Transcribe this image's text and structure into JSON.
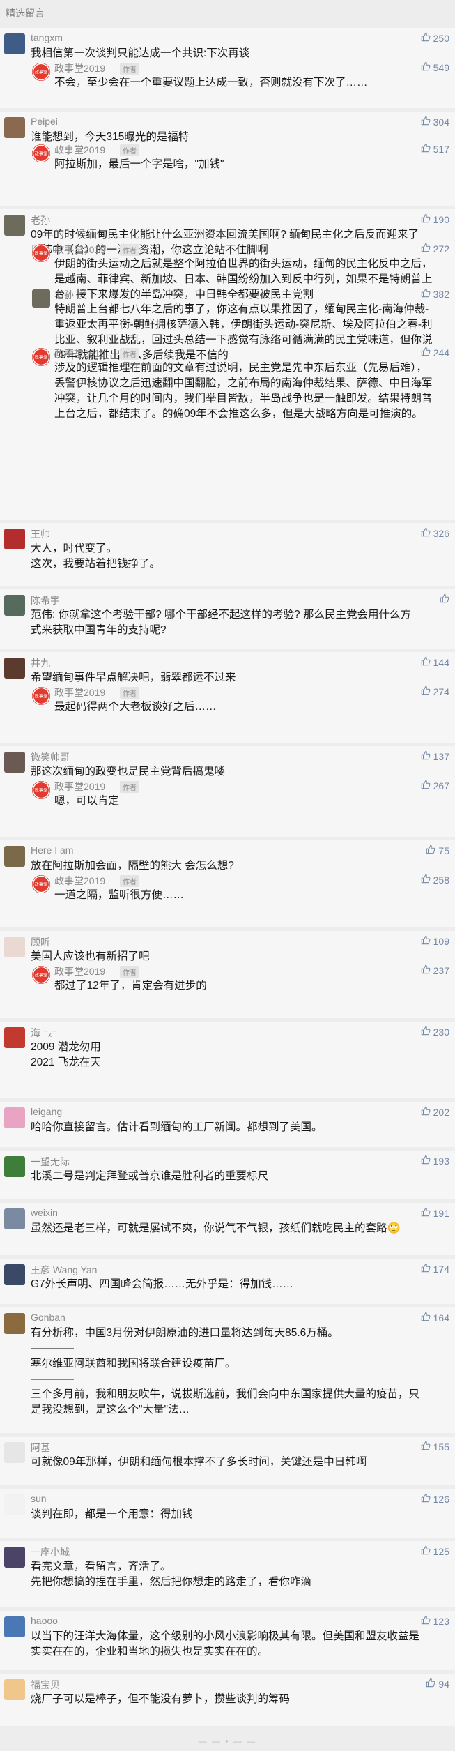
{
  "section_title": "精选留言",
  "author_tag": "作者",
  "reply_avatar_text": "政事堂",
  "emoji_glyph": "😄",
  "comments": [
    {
      "nick": "tangxm",
      "likes": "250",
      "text": "我相信第一次谈判只能达成一个共识:下次再谈",
      "avatar_color": "#3f5c86",
      "replies": [
        {
          "nick": "政事堂2019",
          "likes": "549",
          "text": "不会，至少会在一个重要议题上达成一致，否则就没有下次了……"
        }
      ]
    },
    {
      "nick": "Peipei",
      "likes": "304",
      "text": "谁能想到，今天315曝光的是福特",
      "avatar_color": "#8a6a4e",
      "replies": [
        {
          "nick": "政事堂2019",
          "likes": "517",
          "text": "阿拉斯加，最后一个字是啥，\"加钱\""
        }
      ]
    },
    {
      "nick": "老孙",
      "likes": "190",
      "text": "09年的时候缅甸民主化能让什么亚洲资本回流美国啊? 缅甸民主化之后反而迎来了日韩中（台）的一波投资潮，你这立论站不住脚啊",
      "avatar_color": "#6d6b5b",
      "replies": [
        {
          "nick": "政事堂2019",
          "likes": "272",
          "text": "伊朗的街头运动之后就是整个阿拉伯世界的街头运动，缅甸的民主化反中之后，是越南、菲律宾、新加坡、日本、韩国纷纷加入到反中行列，如果不是特朗普上台，接下来爆发的半岛冲突，中日韩全都要被民主党割"
        },
        {
          "nick": "老孙",
          "likes": "382",
          "text": "特朗普上台都七八年之后的事了，你这有点以果推因了，缅甸民主化-南海仲裁-重返亚太再平衡-朝鲜拥核萨德入韩，伊朗街头运动-突尼斯、埃及阿拉伯之春-利比亚、叙利亚战乱，回过头总结一下感觉有脉络可循满满的民主党味道，但你说09年就能推出这么多后续我是不信的"
        },
        {
          "nick": "政事堂2019",
          "likes": "244",
          "text": "涉及的逻辑推理在前面的文章有过说明，民主党是先中东后东亚（先易后难），丢警伊核协议之后迅速翻中国翻脸，之前布局的南海仲裁结果、萨德、中日海军冲突，让几个月的时间内，我们举目皆敌，半岛战争也是一触即发。结果特朗普上台之后，都结束了。的确09年不会推这么多，但是大战略方向是可推演的。"
        }
      ]
    },
    {
      "nick": "王帅",
      "likes": "326",
      "text": "大人，时代变了。\n这次，我要站着把钱挣了。",
      "avatar_color": "#b32d2d",
      "replies": []
    },
    {
      "nick": "陈希宇",
      "likes": "",
      "text": "范伟: 你就拿这个考验干部? 哪个干部经不起这样的考验? 那么民主党会用什么方式来获取中国青年的支持呢?",
      "avatar_color": "#556b5d",
      "replies": []
    },
    {
      "nick": "井九",
      "likes": "144",
      "text": "希望缅甸事件早点解决吧，翡翠都运不过来",
      "avatar_color": "#5a3b2e",
      "replies": [
        {
          "nick": "政事堂2019",
          "likes": "274",
          "text": "最起码得两个大老板谈好之后……"
        }
      ]
    },
    {
      "nick": "微笑帅哥",
      "likes": "137",
      "text": "那这次缅甸的政变也是民主党背后搞鬼喽",
      "avatar_color": "#6b5a54",
      "replies": [
        {
          "nick": "政事堂2019",
          "likes": "267",
          "text": "嗯，可以肯定"
        }
      ]
    },
    {
      "nick": "Here I am",
      "likes": "75",
      "text": "放在阿拉斯加会面，隔壁的熊大 会怎么想?",
      "avatar_color": "#7b6a4a",
      "replies": [
        {
          "nick": "政事堂2019",
          "likes": "258",
          "text": "一道之隔，监听很方便……"
        }
      ]
    },
    {
      "nick": "顾昕",
      "likes": "109",
      "text": "美国人应该也有新招了吧",
      "avatar_color": "#e9d9d2",
      "replies": [
        {
          "nick": "政事堂2019",
          "likes": "237",
          "text": "都过了12年了，肯定会有进步的"
        }
      ]
    },
    {
      "nick": "海 ⁻ₓ⁻",
      "likes": "230",
      "text": "2009 潜龙勿用\n2021 飞龙在天",
      "avatar_color": "#c23a2f",
      "replies": []
    },
    {
      "nick": "leigang",
      "likes": "202",
      "text": "哈哈你直接留言。估计看到缅甸的工厂新闻。都想到了美国。",
      "avatar_color": "#e9a3c3",
      "replies": []
    },
    {
      "nick": "一望无际",
      "likes": "193",
      "text": "北溪二号是判定拜登或普京谁是胜利者的重要标尺",
      "avatar_color": "#3e7d3a",
      "replies": []
    },
    {
      "nick": "weixin",
      "likes": "191",
      "text": "虽然还是老三样，可就是屡试不爽，你说气不气银，孩纸们就吃民主的套路🙄",
      "avatar_color": "#7a8aa0",
      "replies": []
    },
    {
      "nick": "王彦 Wang Yan",
      "likes": "174",
      "text": "G7外长声明、四国峰会简报……无外乎是：得加钱……",
      "avatar_color": "#3a4a66",
      "replies": []
    },
    {
      "nick": "Gonban",
      "likes": "164",
      "text": "有分析称，中国3月份对伊朗原油的进口量将达到每天85.6万桶。\n————\n塞尔维亚阿联酋和我国将联合建设疫苗厂。\n————\n三个多月前，我和朋友吹牛，说拔斯选前，我们会向中东国家提供大量的疫苗，只是我没想到，是这么个\"大量\"法…",
      "avatar_color": "#8c6a3f",
      "replies": []
    },
    {
      "nick": "阿基",
      "likes": "155",
      "text": "可就像09年那样，伊朗和缅甸根本撑不了多长时间，关键还是中日韩啊",
      "avatar_color": "#e6e6e6",
      "replies": []
    },
    {
      "nick": "sun",
      "likes": "126",
      "text": "谈判在即，都是一个用意：得加钱",
      "avatar_color": "#f2f2f2",
      "replies": []
    },
    {
      "nick": "一座小城",
      "likes": "125",
      "text": "看完文章，看留言，齐活了。\n先把你想搞的捏在手里，然后把你想走的路走了，看你咋滴",
      "avatar_color": "#4b4466",
      "replies": []
    },
    {
      "nick": "haooo",
      "likes": "123",
      "text": "以当下的汪洋大海体量，这个级别的小风小浪影响极其有限。但美国和盟友收益是实实在在的，企业和当地的损失也是实实在在的。",
      "avatar_color": "#4a78b5",
      "replies": []
    },
    {
      "nick": "福宝贝",
      "likes": "94",
      "text": "烧厂子可以是棒子，但不能没有萝卜，攒些谈判的筹码",
      "avatar_color": "#f0c68a",
      "replies": []
    }
  ]
}
